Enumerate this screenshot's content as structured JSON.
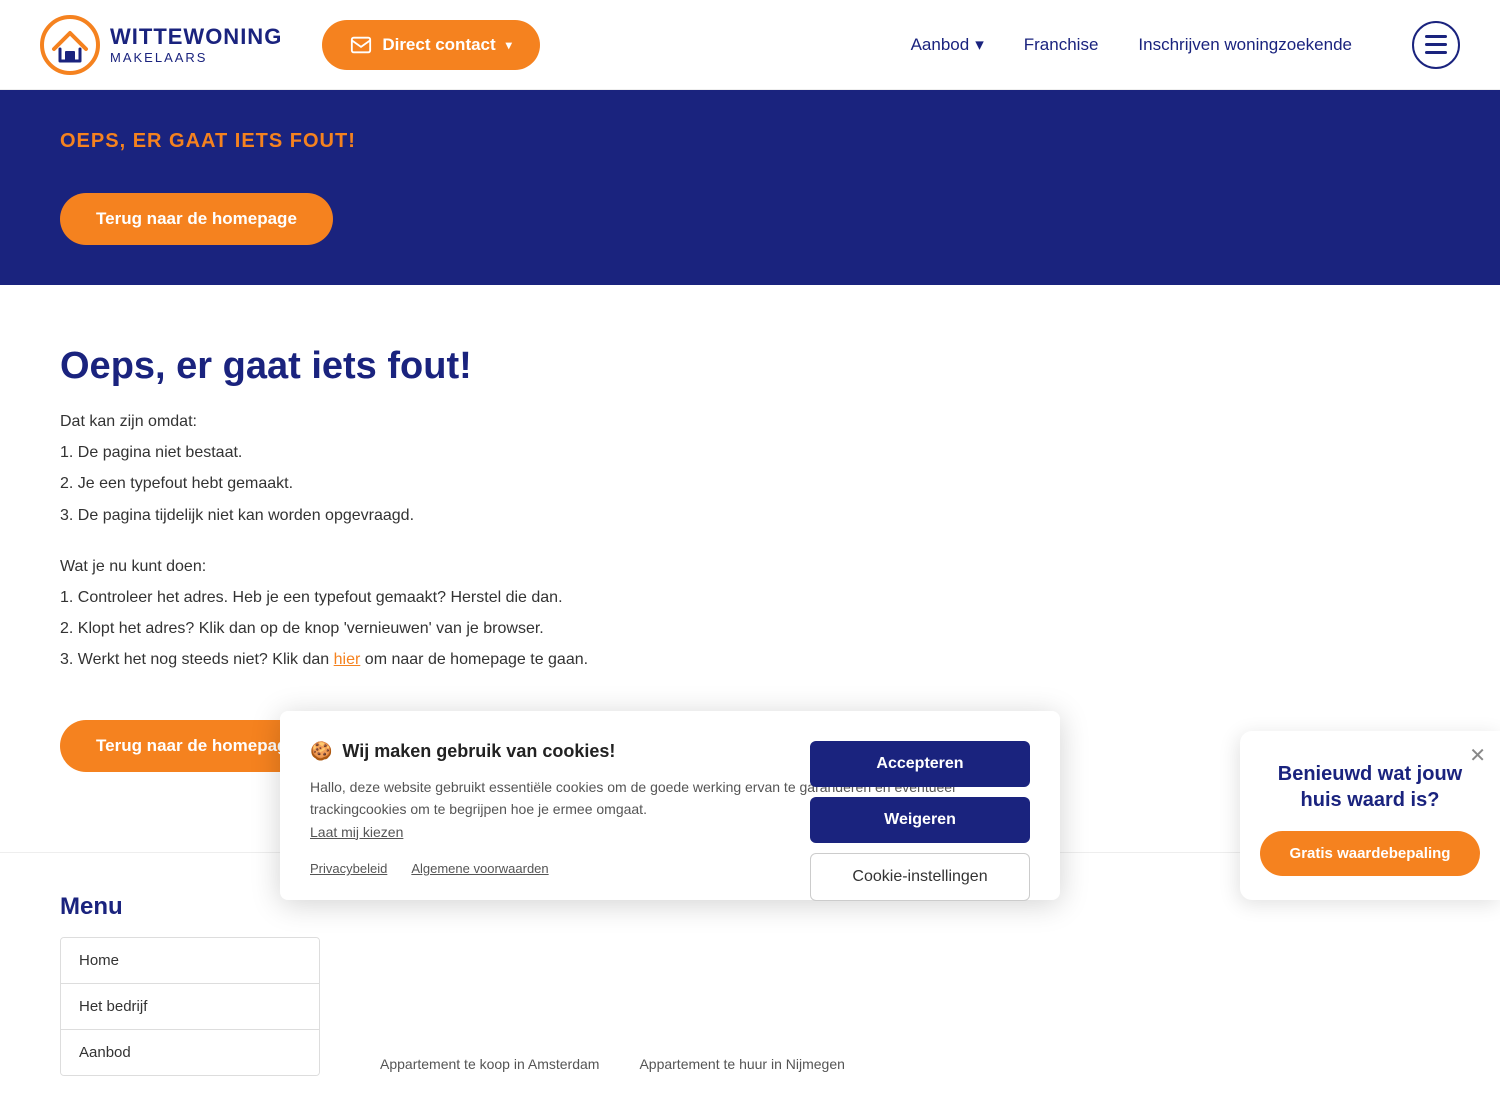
{
  "header": {
    "logo_name": "WITTEWONING",
    "logo_sub": "MAKELAARS",
    "direct_contact_label": "Direct contact",
    "nav_items": [
      {
        "label": "Aanbod",
        "has_dropdown": true
      },
      {
        "label": "Franchise",
        "has_dropdown": false
      },
      {
        "label": "Inschrijven woningzoekende",
        "has_dropdown": false
      }
    ],
    "menu_button_label": "Menu"
  },
  "hero": {
    "error_label": "OEPS, ER GAAT IETS FOUT!",
    "homepage_btn": "Terug naar de homepage"
  },
  "main": {
    "error_heading": "Oeps, er gaat iets fout!",
    "intro": "Dat kan zijn omdat:",
    "reasons": [
      "1. De pagina niet bestaat.",
      "2. Je een typefout hebt gemaakt.",
      "3. De pagina tijdelijk niet kan worden opgevraagd."
    ],
    "action_intro": "Wat je nu kunt doen:",
    "actions": [
      "1. Controleer het adres. Heb je een typefout gemaakt? Herstel die dan.",
      "2. Klopt het adres? Klik dan op de knop 'vernieuwen' van je browser.",
      "3. Werkt het nog steeds niet? Klik dan"
    ],
    "action3_link": "hier",
    "action3_suffix": " om naar de homepage te gaan.",
    "homepage_btn": "Terug naar de homepage"
  },
  "cookie": {
    "title": "Wij maken gebruik van cookies!",
    "cookie_icon": "🍪",
    "body": "Hallo, deze website gebruikt essentiële cookies om de goede werking ervan te garanderen en eventueel trackingcookies om te begrijpen hoe je ermee omgaat.",
    "laat_mij": "Laat mij kiezen",
    "accept_label": "Accepteren",
    "reject_label": "Weigeren",
    "settings_label": "Cookie-instellingen",
    "privacy_label": "Privacybeleid",
    "terms_label": "Algemene voorwaarden"
  },
  "waarde": {
    "title": "Benieuwd wat jouw huis waard is?",
    "btn_label": "Gratis waardebepaling",
    "close_icon": "✕"
  },
  "footer": {
    "menu_title": "Menu",
    "menu_items": [
      "Home",
      "Het bedrijf",
      "Aanbod"
    ],
    "listings_left": "Appartement te koop in Amsterdam",
    "listings_right": "Appartement te huur in Nijmegen"
  }
}
